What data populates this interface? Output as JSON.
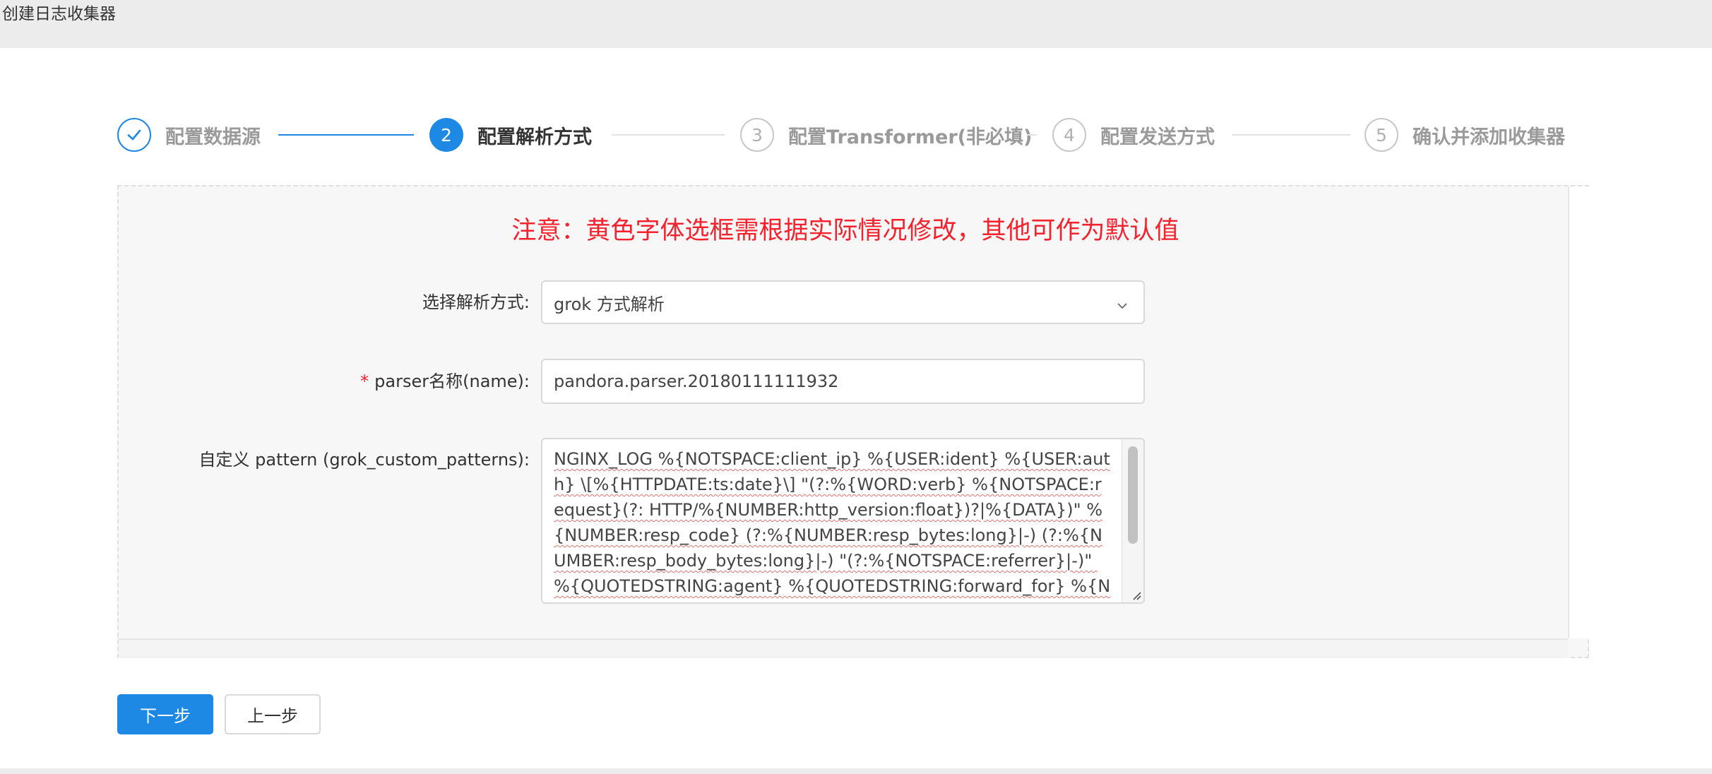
{
  "window": {
    "title": "创建日志收集器"
  },
  "steps": [
    {
      "number": "1",
      "label": "配置数据源",
      "state": "done"
    },
    {
      "number": "2",
      "label": "配置解析方式",
      "state": "active"
    },
    {
      "number": "3",
      "label": "配置Transformer(非必填)",
      "state": "todo"
    },
    {
      "number": "4",
      "label": "配置发送方式",
      "state": "todo"
    },
    {
      "number": "5",
      "label": "确认并添加收集器",
      "state": "todo"
    }
  ],
  "notice": "注意：黄色字体选框需根据实际情况修改，其他可作为默认值",
  "form": {
    "parse_method": {
      "label": "选择解析方式:",
      "value": "grok 方式解析",
      "icon": "chevron-down-icon"
    },
    "parser_name": {
      "label": "parser名称(name):",
      "required_mark": "*",
      "value": "pandora.parser.20180111111932"
    },
    "custom_patterns": {
      "label": "自定义 pattern (grok_custom_patterns):",
      "value": "NGINX_LOG %{NOTSPACE:client_ip} %{USER:ident} %{USER:auth} \\[%{HTTPDATE:ts:date}\\] \"(?:%{WORD:verb} %{NOTSPACE:request}(?: HTTP/%{NUMBER:http_version:float})?|%{DATA})\" %{NUMBER:resp_code} (?:%{NUMBER:resp_bytes:long}|-) (?:%{NUMBER:resp_body_bytes:long}|-) \"(?:%{NOTSPACE:referrer}|-)\" %{QUOTEDSTRING:agent} %{QUOTEDSTRING:forward_for} %{NOTSPACE:upstream_addr}"
    }
  },
  "buttons": {
    "next": "下一步",
    "prev": "上一步"
  },
  "colors": {
    "primary": "#1e88e5",
    "notice": "#f5222d",
    "required": "#f5222d"
  }
}
